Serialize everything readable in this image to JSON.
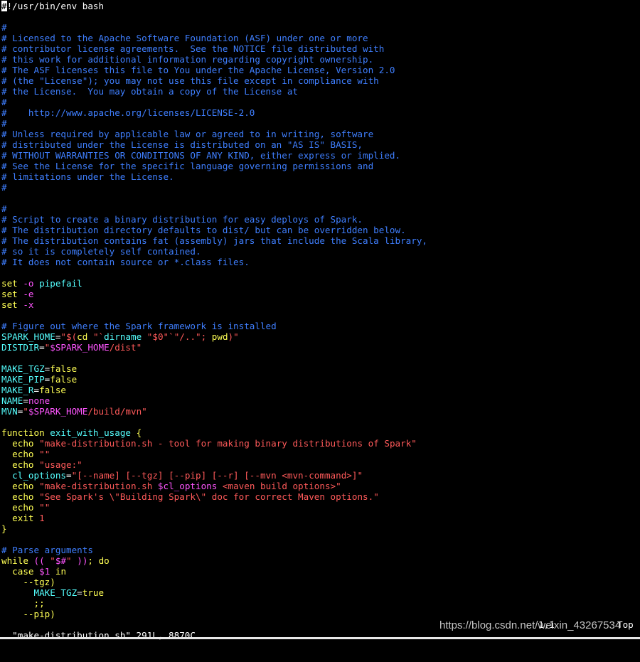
{
  "colors": {
    "background": "#000000",
    "text": "#ffffff",
    "comment": "#3f7fff",
    "keyword": "#ffff55",
    "string": "#ff5a5a",
    "variable": "#55ffff",
    "option": "#ff55ff",
    "cursor": "#ffffff"
  },
  "editor": {
    "lines": [
      [
        [
          "c",
          "#"
        ],
        [
          "t",
          "!/usr/bin/env bash"
        ]
      ],
      [],
      [
        [
          "c",
          "#"
        ]
      ],
      [
        [
          "c",
          "# Licensed to the Apache Software Foundation (ASF) under one or more"
        ]
      ],
      [
        [
          "c",
          "# contributor license agreements.  See the NOTICE file distributed with"
        ]
      ],
      [
        [
          "c",
          "# this work for additional information regarding copyright ownership."
        ]
      ],
      [
        [
          "c",
          "# The ASF licenses this file to You under the Apache License, Version 2.0"
        ]
      ],
      [
        [
          "c",
          "# (the \"License\"); you may not use this file except in compliance with"
        ]
      ],
      [
        [
          "c",
          "# the License.  You may obtain a copy of the License at"
        ]
      ],
      [
        [
          "c",
          "#"
        ]
      ],
      [
        [
          "c",
          "#    http://www.apache.org/licenses/LICENSE-2.0"
        ]
      ],
      [
        [
          "c",
          "#"
        ]
      ],
      [
        [
          "c",
          "# Unless required by applicable law or agreed to in writing, software"
        ]
      ],
      [
        [
          "c",
          "# distributed under the License is distributed on an \"AS IS\" BASIS,"
        ]
      ],
      [
        [
          "c",
          "# WITHOUT WARRANTIES OR CONDITIONS OF ANY KIND, either express or implied."
        ]
      ],
      [
        [
          "c",
          "# See the License for the specific language governing permissions and"
        ]
      ],
      [
        [
          "c",
          "# limitations under the License."
        ]
      ],
      [
        [
          "c",
          "#"
        ]
      ],
      [],
      [
        [
          "c",
          "#"
        ]
      ],
      [
        [
          "c",
          "# Script to create a binary distribution for easy deploys of Spark."
        ]
      ],
      [
        [
          "c",
          "# The distribution directory defaults to dist/ but can be overridden below."
        ]
      ],
      [
        [
          "c",
          "# The distribution contains fat (assembly) jars that include the Scala library,"
        ]
      ],
      [
        [
          "c",
          "# so it is completely self contained."
        ]
      ],
      [
        [
          "c",
          "# It does not contain source or *.class files."
        ]
      ],
      [],
      [
        [
          "k",
          "set"
        ],
        [
          "t",
          " "
        ],
        [
          "o",
          "-o"
        ],
        [
          "t",
          " "
        ],
        [
          "v",
          "pipefail"
        ]
      ],
      [
        [
          "k",
          "set"
        ],
        [
          "t",
          " "
        ],
        [
          "o",
          "-e"
        ]
      ],
      [
        [
          "k",
          "set"
        ],
        [
          "t",
          " "
        ],
        [
          "o",
          "-x"
        ]
      ],
      [],
      [
        [
          "c",
          "# Figure out where the Spark framework is installed"
        ]
      ],
      [
        [
          "v",
          "SPARK_HOME"
        ],
        [
          "t",
          "="
        ],
        [
          "s",
          "\"$("
        ],
        [
          "k",
          "cd"
        ],
        [
          "t",
          " "
        ],
        [
          "s",
          "\"`"
        ],
        [
          "v",
          "dirname"
        ],
        [
          "t",
          " "
        ],
        [
          "s",
          "\"$0\""
        ],
        [
          "s",
          "`\"/..\"; "
        ],
        [
          "k",
          "pwd"
        ],
        [
          "s",
          ")\""
        ]
      ],
      [
        [
          "v",
          "DISTDIR"
        ],
        [
          "t",
          "="
        ],
        [
          "s",
          "\""
        ],
        [
          "o",
          "$SPARK_HOME"
        ],
        [
          "s",
          "/dist\""
        ]
      ],
      [],
      [
        [
          "v",
          "MAKE_TGZ"
        ],
        [
          "t",
          "="
        ],
        [
          "k",
          "false"
        ]
      ],
      [
        [
          "v",
          "MAKE_PIP"
        ],
        [
          "t",
          "="
        ],
        [
          "k",
          "false"
        ]
      ],
      [
        [
          "v",
          "MAKE_R"
        ],
        [
          "t",
          "="
        ],
        [
          "k",
          "false"
        ]
      ],
      [
        [
          "v",
          "NAME"
        ],
        [
          "t",
          "="
        ],
        [
          "o",
          "none"
        ]
      ],
      [
        [
          "v",
          "MVN"
        ],
        [
          "t",
          "="
        ],
        [
          "s",
          "\""
        ],
        [
          "o",
          "$SPARK_HOME"
        ],
        [
          "s",
          "/build/mvn\""
        ]
      ],
      [],
      [
        [
          "k",
          "function"
        ],
        [
          "t",
          " "
        ],
        [
          "v",
          "exit_with_usage"
        ],
        [
          "t",
          " "
        ],
        [
          "k",
          "{"
        ]
      ],
      [
        [
          "t",
          "  "
        ],
        [
          "k",
          "echo"
        ],
        [
          "t",
          " "
        ],
        [
          "s",
          "\"make-distribution.sh - tool for making binary distributions of Spark\""
        ]
      ],
      [
        [
          "t",
          "  "
        ],
        [
          "k",
          "echo"
        ],
        [
          "t",
          " "
        ],
        [
          "s",
          "\"\""
        ]
      ],
      [
        [
          "t",
          "  "
        ],
        [
          "k",
          "echo"
        ],
        [
          "t",
          " "
        ],
        [
          "s",
          "\"usage:\""
        ]
      ],
      [
        [
          "t",
          "  "
        ],
        [
          "v",
          "cl_options"
        ],
        [
          "t",
          "="
        ],
        [
          "s",
          "\"[--name] [--tgz] [--pip] [--r] [--mvn <mvn-command>]\""
        ]
      ],
      [
        [
          "t",
          "  "
        ],
        [
          "k",
          "echo"
        ],
        [
          "t",
          " "
        ],
        [
          "s",
          "\"make-distribution.sh "
        ],
        [
          "o",
          "$cl_options"
        ],
        [
          "s",
          " <maven build options>\""
        ]
      ],
      [
        [
          "t",
          "  "
        ],
        [
          "k",
          "echo"
        ],
        [
          "t",
          " "
        ],
        [
          "s",
          "\"See Spark's \\\"Building Spark\\\" doc for correct Maven options.\""
        ]
      ],
      [
        [
          "t",
          "  "
        ],
        [
          "k",
          "echo"
        ],
        [
          "t",
          " "
        ],
        [
          "s",
          "\"\""
        ]
      ],
      [
        [
          "t",
          "  "
        ],
        [
          "k",
          "exit"
        ],
        [
          "t",
          " "
        ],
        [
          "s",
          "1"
        ]
      ],
      [
        [
          "k",
          "}"
        ]
      ],
      [],
      [
        [
          "c",
          "# Parse arguments"
        ]
      ],
      [
        [
          "k",
          "while"
        ],
        [
          "t",
          " "
        ],
        [
          "o",
          "(("
        ],
        [
          "t",
          " "
        ],
        [
          "s",
          "\""
        ],
        [
          "o",
          "$#"
        ],
        [
          "s",
          "\""
        ],
        [
          "t",
          " "
        ],
        [
          "o",
          "))"
        ],
        [
          "k",
          "; do"
        ]
      ],
      [
        [
          "t",
          "  "
        ],
        [
          "k",
          "case"
        ],
        [
          "t",
          " "
        ],
        [
          "o",
          "$1"
        ],
        [
          "t",
          " "
        ],
        [
          "k",
          "in"
        ]
      ],
      [
        [
          "t",
          "    "
        ],
        [
          "k",
          "--tgz)"
        ]
      ],
      [
        [
          "t",
          "      "
        ],
        [
          "v",
          "MAKE_TGZ"
        ],
        [
          "t",
          "="
        ],
        [
          "k",
          "true"
        ]
      ],
      [
        [
          "t",
          "      "
        ],
        [
          "k",
          ";;"
        ]
      ],
      [
        [
          "t",
          "    "
        ],
        [
          "k",
          "--pip)"
        ]
      ]
    ]
  },
  "status_bar": {
    "file_info": "\"make-distribution.sh\" 291L, 8870C",
    "cursor_position": "1,1",
    "scroll_position": "Top"
  },
  "watermark": "https://blog.csdn.net/weixin_43267534"
}
